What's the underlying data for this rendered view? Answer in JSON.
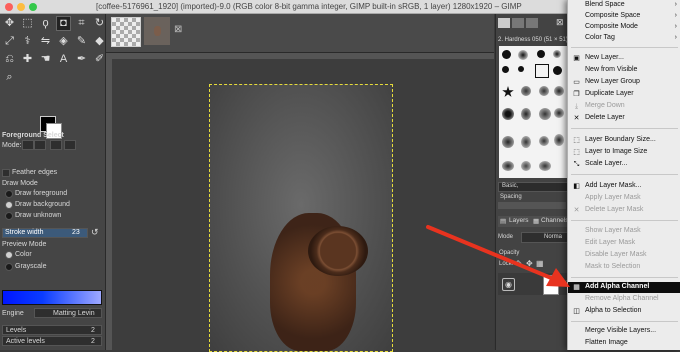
{
  "window": {
    "title": "[coffee-5176961_1920] (imported)-9.0 (RGB color 8-bit gamma integer, GIMP built-in sRGB, 1 layer) 1280x1920 – GIMP",
    "traffic_colors": [
      "#fc605c",
      "#fdbc40",
      "#34c84a"
    ]
  },
  "toolbox": {
    "tools": [
      "move",
      "rect-select",
      "lasso",
      "fuzzy-select",
      "crop",
      "rotate",
      "warp",
      "flip",
      "paint",
      "bucket",
      "pencil",
      "brush",
      "eraser",
      "clone",
      "smudge",
      "text",
      "path",
      "dodge",
      "zoom"
    ],
    "options_title": "Foreground Select",
    "mode_label": "Mode:",
    "feather_label": "Feather edges",
    "draw_mode_label": "Draw Mode",
    "draw_options": [
      "Draw foreground",
      "Draw background",
      "Draw unknown"
    ],
    "stroke_label": "Stroke width",
    "stroke_value": "23",
    "preview_mode_label": "Preview Mode",
    "preview_options": [
      "Color",
      "Grayscale"
    ],
    "engine_label": "Engine",
    "engine_value": "Matting Levin",
    "levels_label": "Levels",
    "levels_value": "2",
    "active_levels_label": "Active levels",
    "active_levels_value": "2"
  },
  "right_dock": {
    "brush_header": "2. Hardness 050 (51 × 51)",
    "basic_label": "Basic,",
    "spacing_label": "Spacing",
    "layers_tab": "Layers",
    "channels_tab": "Channels",
    "mode_label": "Mode",
    "mode_value": "Norma",
    "opacity_label": "Opacity",
    "lock_label": "Lock:",
    "layer_name": "coff"
  },
  "context_menu": {
    "top_items": [
      {
        "label": "Blend Space",
        "submenu": true
      },
      {
        "label": "Composite Space",
        "submenu": true
      },
      {
        "label": "Composite Mode",
        "submenu": true
      },
      {
        "label": "Color Tag",
        "submenu": true
      }
    ],
    "group1": [
      {
        "label": "New Layer...",
        "enabled": true
      },
      {
        "label": "New from Visible",
        "enabled": true
      },
      {
        "label": "New Layer Group",
        "enabled": true
      },
      {
        "label": "Duplicate Layer",
        "enabled": true
      },
      {
        "label": "Merge Down",
        "enabled": false
      },
      {
        "label": "Delete Layer",
        "enabled": true
      }
    ],
    "group2": [
      {
        "label": "Layer Boundary Size...",
        "enabled": true
      },
      {
        "label": "Layer to Image Size",
        "enabled": true
      },
      {
        "label": "Scale Layer...",
        "enabled": true
      }
    ],
    "group3": [
      {
        "label": "Add Layer Mask...",
        "enabled": true
      },
      {
        "label": "Apply Layer Mask",
        "enabled": false
      },
      {
        "label": "Delete Layer Mask",
        "enabled": false
      }
    ],
    "group4": [
      {
        "label": "Show Layer Mask",
        "enabled": false
      },
      {
        "label": "Edit Layer Mask",
        "enabled": false
      },
      {
        "label": "Disable Layer Mask",
        "enabled": false
      },
      {
        "label": "Mask to Selection",
        "enabled": false
      }
    ],
    "group5": [
      {
        "label": "Add Alpha Channel",
        "enabled": true,
        "highlighted": true
      },
      {
        "label": "Remove Alpha Channel",
        "enabled": false
      },
      {
        "label": "Alpha to Selection",
        "enabled": true
      }
    ],
    "group6": [
      {
        "label": "Merge Visible Layers...",
        "enabled": true
      },
      {
        "label": "Flatten Image",
        "enabled": true
      }
    ]
  },
  "annotation": {
    "arrow_color": "#e8331f"
  }
}
